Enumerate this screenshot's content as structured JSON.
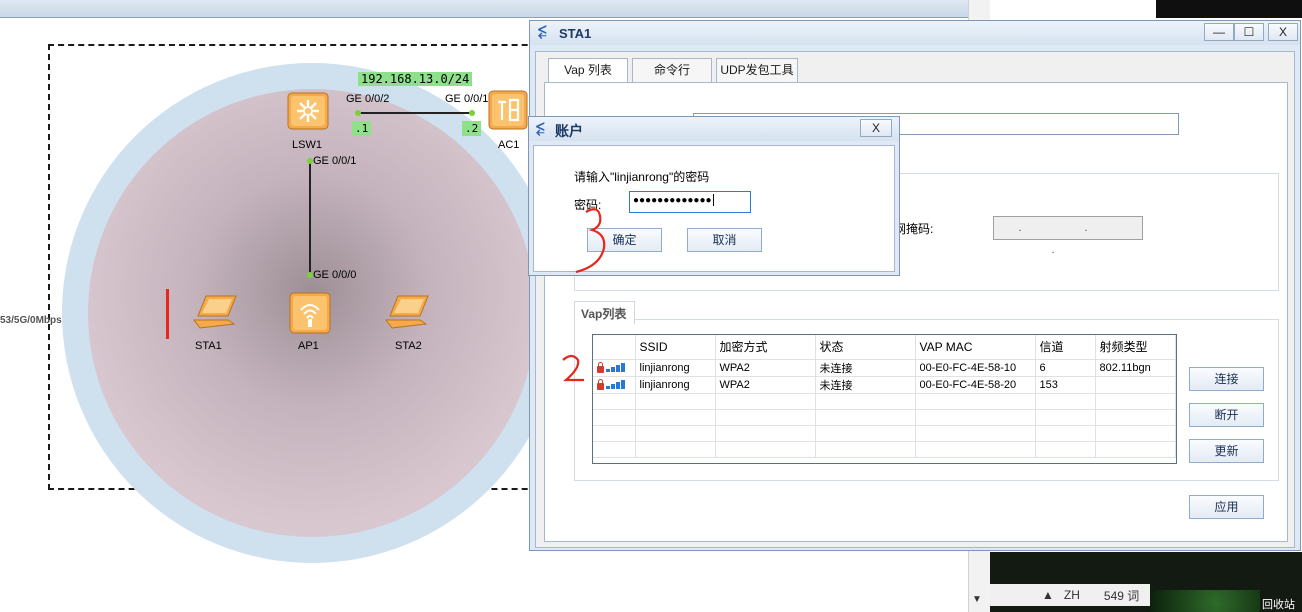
{
  "topology": {
    "subnet_label": "192.168.13.0/24",
    "lsw1": {
      "name": "LSW1",
      "port_ac": "GE 0/0/2",
      "port_ap": "GE 0/0/1",
      "ip": ".1"
    },
    "ac1": {
      "name": "AC1",
      "port": "GE 0/0/1",
      "ip": ".2"
    },
    "ap1": {
      "name": "AP1",
      "port": "GE 0/0/0"
    },
    "sta1": {
      "name": "STA1"
    },
    "sta2": {
      "name": "STA2"
    },
    "rate_label": "53/5G/0Mbps"
  },
  "taskbar": {
    "input_indicator": "ZH",
    "word_count": "549 词",
    "recycle_bin": "回收站"
  },
  "sta_window": {
    "title": "STA1",
    "min_label": "—",
    "max_label": "☐",
    "close_label": "X",
    "tabs": [
      "Vap 列表",
      "命令行",
      "UDP发包工具"
    ],
    "subnet_mask_label": "子网掩码:",
    "subnet_mask_value": ". . .",
    "vap_section_label": "Vap列表",
    "vap_table": {
      "columns": [
        "SSID",
        "加密方式",
        "状态",
        "VAP MAC",
        "信道",
        "射频类型"
      ],
      "rows": [
        [
          "linjianrong",
          "WPA2",
          "未连接",
          "00-E0-FC-4E-58-10",
          "6",
          "802.11bgn"
        ],
        [
          "linjianrong",
          "WPA2",
          "未连接",
          "00-E0-FC-4E-58-20",
          "153",
          ""
        ]
      ]
    },
    "buttons": {
      "connect": "连接",
      "disconnect": "断开",
      "refresh": "更新",
      "apply": "应用"
    }
  },
  "account_dialog": {
    "title": "账户",
    "close_label": "X",
    "prompt": "请输入\"linjianrong\"的密码",
    "password_label": "密码:",
    "password_value": "●●●●●●●●●●●●●",
    "ok_label": "确定",
    "cancel_label": "取消"
  },
  "annotations": {
    "mark_3": "3",
    "mark_2": "2",
    "color": "#e8261c"
  }
}
